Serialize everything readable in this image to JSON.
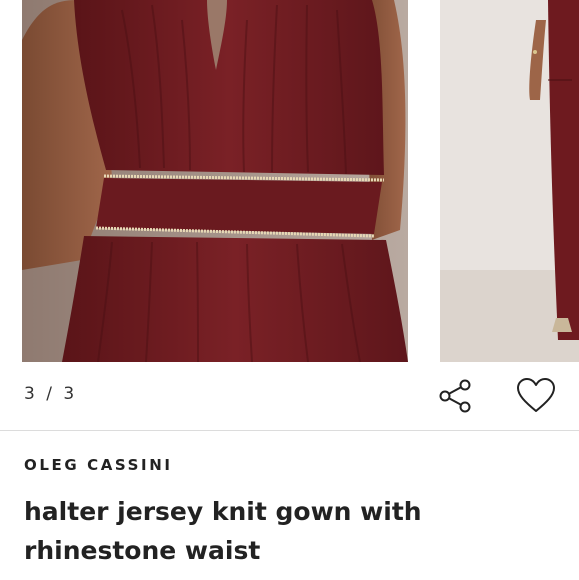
{
  "gallery": {
    "current_image_alt": "Burgundy halter jersey knit gown, close-up of bodice with rhinestone waist",
    "next_image_alt": "Burgundy halter gown, full-length view",
    "counter": "3 / 3",
    "dress_color": "#6e1a1f"
  },
  "actions": {
    "share_icon": "share-icon",
    "favorite_icon": "heart-icon"
  },
  "product": {
    "brand": "OLEG CASSINI",
    "name": "halter jersey knit gown with rhinestone waist"
  }
}
